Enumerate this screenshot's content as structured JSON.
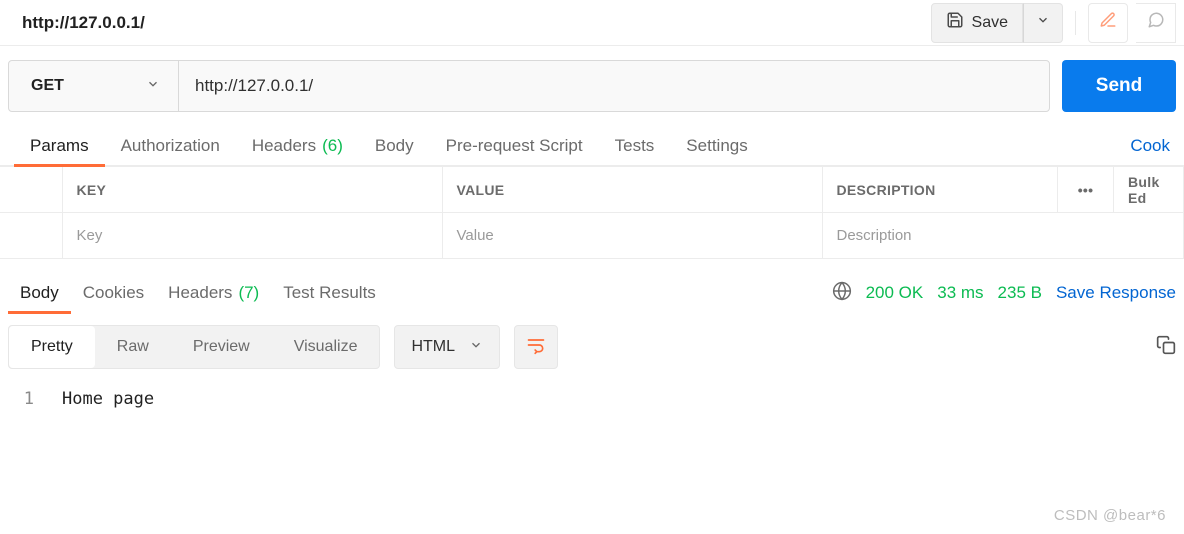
{
  "header": {
    "title": "http://127.0.0.1/",
    "save_label": "Save"
  },
  "request": {
    "method": "GET",
    "url": "http://127.0.0.1/",
    "send_label": "Send"
  },
  "req_tabs": {
    "params": "Params",
    "auth": "Authorization",
    "headers": "Headers",
    "headers_count": "(6)",
    "body": "Body",
    "pre": "Pre-request Script",
    "tests": "Tests",
    "settings": "Settings",
    "cookies_link": "Cook"
  },
  "params_table": {
    "header_key": "KEY",
    "header_value": "VALUE",
    "header_desc": "DESCRIPTION",
    "bulk": "Bulk Ed",
    "ph_key": "Key",
    "ph_value": "Value",
    "ph_desc": "Description"
  },
  "resp_tabs": {
    "body": "Body",
    "cookies": "Cookies",
    "headers": "Headers",
    "headers_count": "(7)",
    "test_results": "Test Results"
  },
  "resp_meta": {
    "status": "200 OK",
    "time": "33 ms",
    "size": "235 B",
    "save": "Save Response"
  },
  "viewer": {
    "pretty": "Pretty",
    "raw": "Raw",
    "preview": "Preview",
    "visualize": "Visualize",
    "format": "HTML"
  },
  "code": {
    "line_no": "1",
    "line_1": "Home page"
  },
  "watermark": "CSDN @bear*6"
}
